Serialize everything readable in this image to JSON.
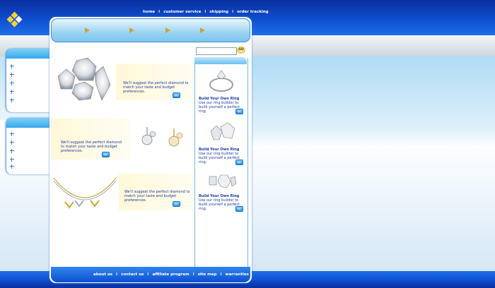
{
  "header": {
    "nav": [
      "home",
      "customer service",
      "shipping",
      "order tracking"
    ],
    "separator": "I"
  },
  "search": {
    "placeholder": "",
    "go_label": "GO"
  },
  "promos": [
    {
      "text": "We'll suggest the perfect diamond to match your taste and budget preferences."
    },
    {
      "text": "We'll suggest the perfect diamond to match your taste and budget preferences."
    },
    {
      "text": "We'll suggest the perfect diamond to match your taste and budget preferences."
    }
  ],
  "sidebar_right": {
    "items": [
      {
        "title": "Build Your Own Ring",
        "text": "Use our ring builder to build yourself a perfect ring."
      },
      {
        "title": "Build Your Own Ring",
        "text": "Use our ring builder to build yourself a perfect ring."
      },
      {
        "title": "Build Your Own Ring",
        "text": "Use our ring builder to build yourself a perfect ring."
      }
    ]
  },
  "footer": {
    "nav": [
      "about us",
      "contact us",
      "affiliate program",
      "site map",
      "warranties"
    ],
    "separator": "I"
  },
  "colors": {
    "brand_blue": "#0f52d2",
    "accent_gold": "#c9a63a",
    "text_blue": "#1f3a9e"
  }
}
